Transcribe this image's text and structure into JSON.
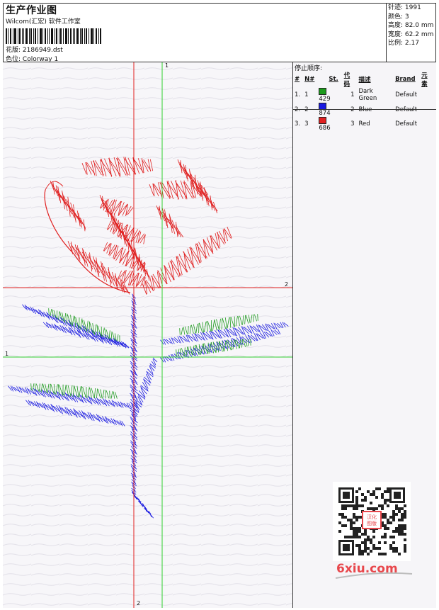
{
  "header": {
    "title": "生产作业图",
    "subtitle": "Wilcom(汇宏) 软件工作室",
    "design_label": "花版:",
    "design_value": "2186949.dst",
    "colorway_label": "色位:",
    "colorway_value": "Colorway 1"
  },
  "stats": [
    {
      "label": "针迹:",
      "value": "1991"
    },
    {
      "label": "颜色:",
      "value": "3"
    },
    {
      "label": "高度:",
      "value": "82.0 mm"
    },
    {
      "label": "宽度:",
      "value": "62.2 mm"
    },
    {
      "label": "比例:",
      "value": "2.17"
    }
  ],
  "stop_sequence": {
    "title": "停止顺序:",
    "columns": [
      "#",
      "N#",
      "St.",
      "代码",
      "描述",
      "Brand",
      "元素"
    ],
    "rows": [
      {
        "index": "1.",
        "needle": "1",
        "color": "#1c9a1c",
        "stitches": "429",
        "code": "1",
        "description": "Dark Green",
        "brand": "Default",
        "element": ""
      },
      {
        "index": "2.",
        "needle": "2",
        "color": "#1a1ae0",
        "stitches": "874",
        "code": "2",
        "description": "Blue",
        "brand": "Default",
        "element": ""
      },
      {
        "index": "3.",
        "needle": "3",
        "color": "#e02020",
        "stitches": "686",
        "code": "3",
        "description": "Red",
        "brand": "Default",
        "element": ""
      }
    ]
  },
  "crosshair_labels": {
    "v1_top": "1",
    "h2_right": "2",
    "h1_left": "1",
    "v2_bottom": "2"
  },
  "watermark": {
    "text": "6xiu.com",
    "stamp": "汉化图版"
  }
}
